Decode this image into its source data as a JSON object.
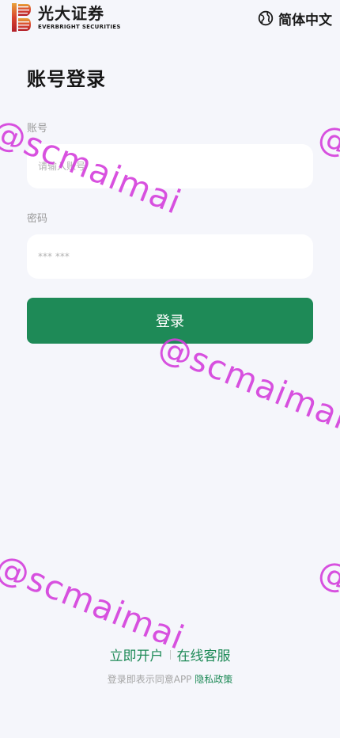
{
  "brand": {
    "name_cn": "光大证券",
    "name_en": "EVERBRIGHT SECURITIES",
    "logo_icon": "everbright-logo-icon"
  },
  "header": {
    "language_label": "简体中文",
    "language_icon": "globe-icon"
  },
  "login": {
    "title": "账号登录",
    "account": {
      "label": "账号",
      "placeholder": "请输入账号",
      "value": ""
    },
    "password": {
      "label": "密码",
      "placeholder": "*** ***",
      "value": ""
    },
    "submit_label": "登录"
  },
  "footer": {
    "open_account": "立即开户",
    "online_service": "在线客服",
    "agreement_prefix": "登录即表示同意APP",
    "privacy_policy": "隐私政策"
  },
  "watermark": {
    "text": "@scmaimai",
    "color": "#d43fdc"
  },
  "colors": {
    "accent": "#1e8a57",
    "background": "#f5f6fb"
  }
}
